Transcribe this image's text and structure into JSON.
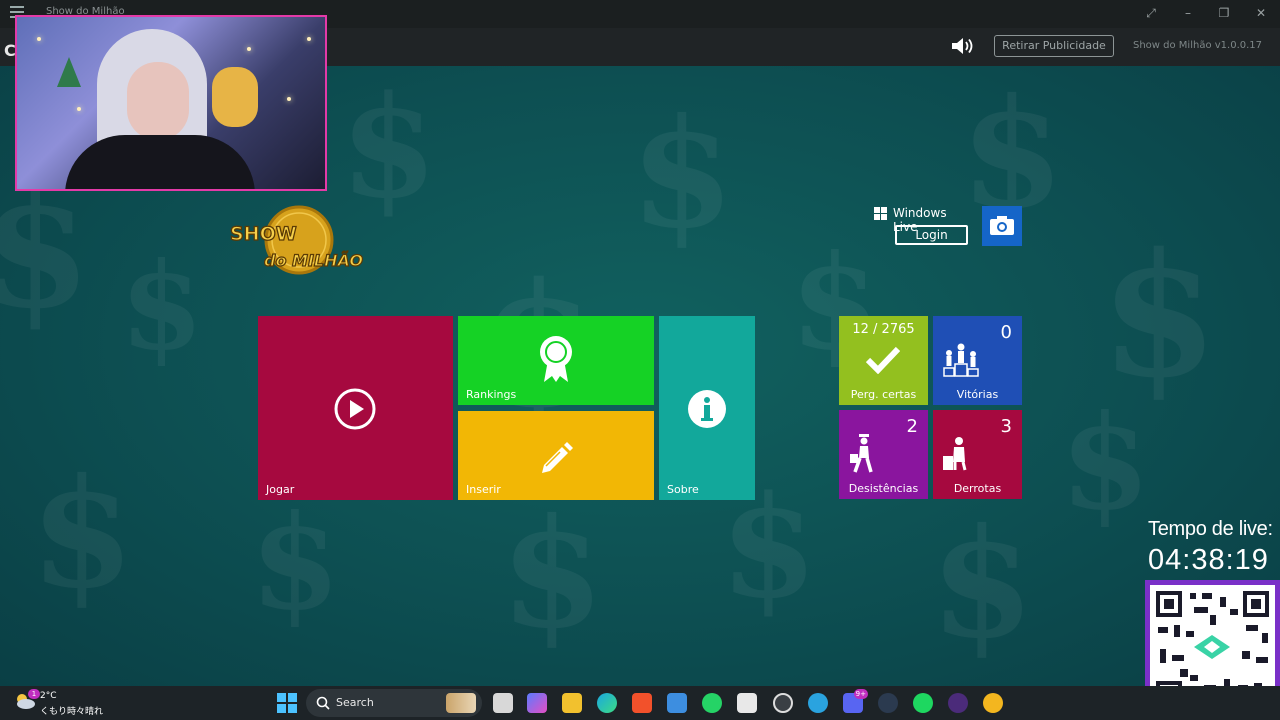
{
  "window": {
    "title": "Show do Milhão"
  },
  "header": {
    "ads_button": "Retirar Publicidade",
    "version": "Show do Milhão v1.0.0.17",
    "back_letter": "C"
  },
  "login": {
    "brand": "Windows Live",
    "button": "Login"
  },
  "logo": {
    "line1": "SHOW",
    "line2": "do MILHÃO"
  },
  "tiles": {
    "jogar": {
      "label": "Jogar",
      "color": "#a6093f"
    },
    "rankings": {
      "label": "Rankings",
      "color": "#15d225"
    },
    "inserir": {
      "label": "Inserir",
      "color": "#f2b705"
    },
    "sobre": {
      "label": "Sobre",
      "color": "#12a89b"
    }
  },
  "stats": {
    "perg_certas": {
      "label": "Perg. certas",
      "value": "12 / 2765",
      "color": "#93c01f"
    },
    "vitorias": {
      "label": "Vitórias",
      "value": "0",
      "color": "#1f4fb5"
    },
    "desistencias": {
      "label": "Desistências",
      "value": "2",
      "color": "#8a159e"
    },
    "derrotas": {
      "label": "Derrotas",
      "value": "3",
      "color": "#a6093f"
    }
  },
  "overlay": {
    "live_label": "Tempo de live:",
    "live_time": "04:38:19"
  },
  "taskbar": {
    "weather_temp": "2°C",
    "weather_cond": "くもり時々晴れ",
    "weather_badge": "1",
    "search_placeholder": "Search",
    "discord_badge": "9+"
  }
}
